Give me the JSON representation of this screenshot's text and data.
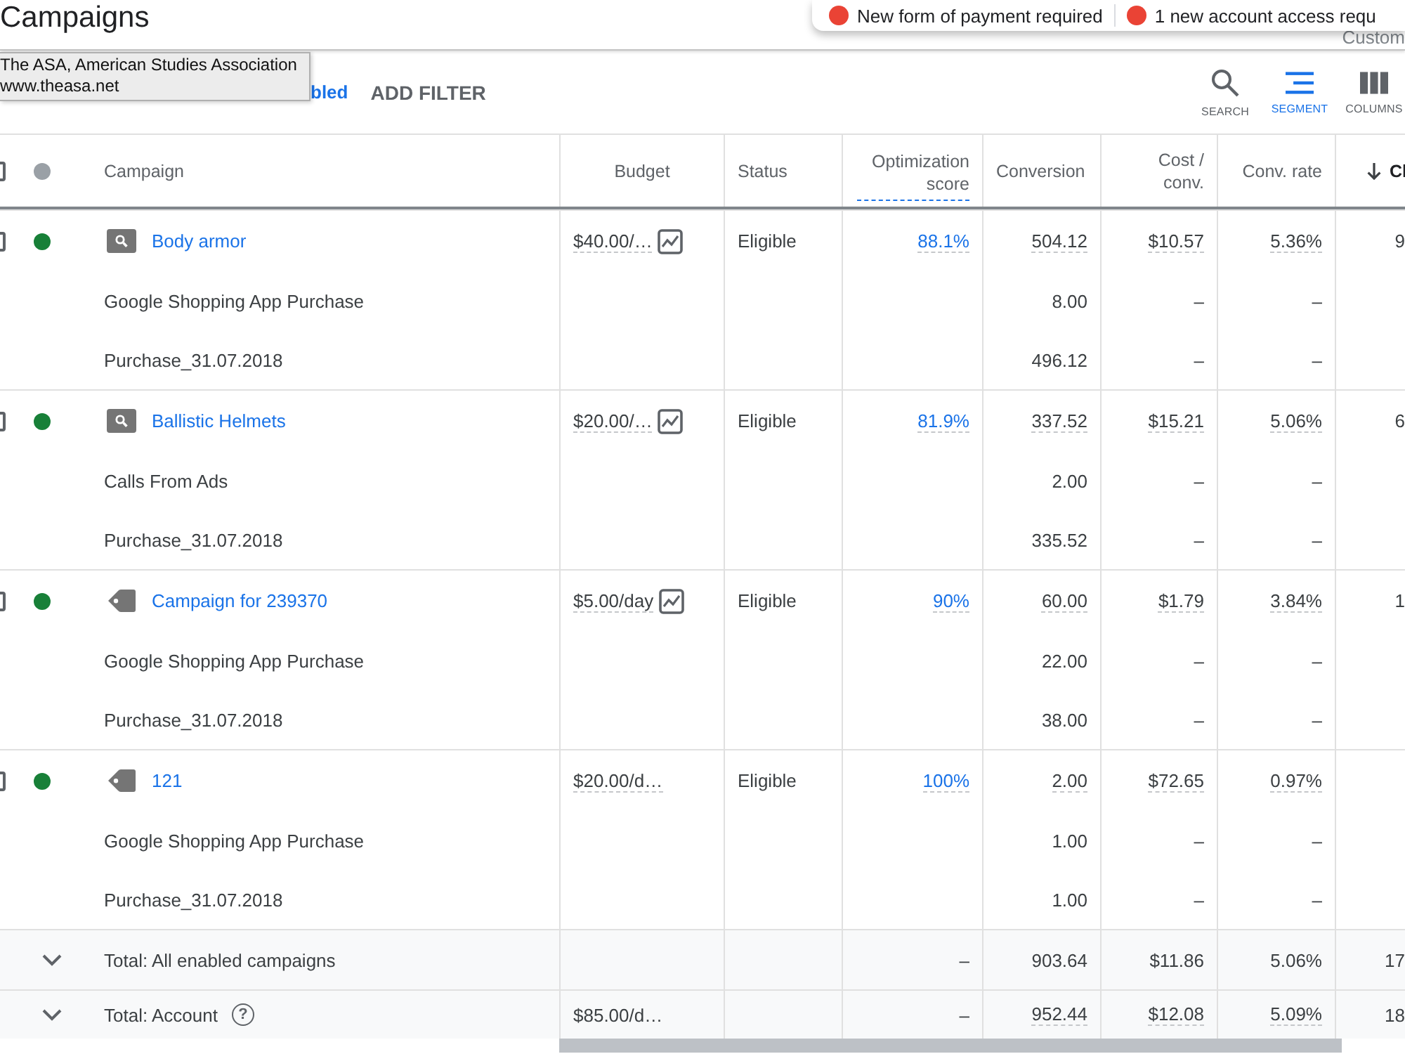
{
  "page": {
    "title": "Campaigns",
    "header_text": "Custom"
  },
  "notifications": [
    {
      "kind": "error",
      "text": "New form of payment required"
    },
    {
      "kind": "error",
      "text": "1 new account access requ"
    }
  ],
  "tooltip": {
    "lines": [
      "The ASA, American Studies Association",
      "www.theasa.net"
    ]
  },
  "filter_bar": {
    "chip_text": "bled",
    "add_filter": "ADD FILTER"
  },
  "toolbar": [
    {
      "kind": "search",
      "label": "SEARCH",
      "selected": false
    },
    {
      "kind": "segment",
      "label": "SEGMENT",
      "selected": true
    },
    {
      "kind": "columns",
      "label": "COLUMNS",
      "selected": false
    }
  ],
  "table": {
    "header": {
      "checked": false,
      "campaign": "Campaign",
      "budget": "Budget",
      "status": "Status",
      "optimization_score": "Optimization score",
      "conversions": "Conversion",
      "cost_per_conv": "Cost / conv.",
      "conv_rate": "Conv. rate",
      "column_10": "Cl",
      "sort_descending": true
    },
    "campaigns": [
      {
        "checked": false,
        "enabled": true,
        "kind": "search",
        "name": "Body armor",
        "budget": "$40.00/…",
        "budget_chart": true,
        "status": "Eligible",
        "optimization_score": "88.1%",
        "conversions": "504.12",
        "cost_per_conv": "$10.57",
        "conv_rate": "5.36%",
        "column_10": "9",
        "conversion_actions": [
          {
            "name": "Google Shopping App Purchase",
            "conversions": "8.00",
            "cost_per_conv": "–",
            "conv_rate": "–"
          },
          {
            "name": "Purchase_31.07.2018",
            "conversions": "496.12",
            "cost_per_conv": "–",
            "conv_rate": "–"
          }
        ]
      },
      {
        "checked": false,
        "enabled": true,
        "kind": "search",
        "name": "Ballistic Helmets",
        "budget": "$20.00/…",
        "budget_chart": true,
        "status": "Eligible",
        "optimization_score": "81.9%",
        "conversions": "337.52",
        "cost_per_conv": "$15.21",
        "conv_rate": "5.06%",
        "column_10": "6",
        "conversion_actions": [
          {
            "name": "Calls From Ads",
            "conversions": "2.00",
            "cost_per_conv": "–",
            "conv_rate": "–"
          },
          {
            "name": "Purchase_31.07.2018",
            "conversions": "335.52",
            "cost_per_conv": "–",
            "conv_rate": "–"
          }
        ]
      },
      {
        "checked": false,
        "enabled": true,
        "kind": "shopping",
        "name": "Campaign for 239370",
        "budget": "$5.00/day",
        "budget_chart": true,
        "status": "Eligible",
        "optimization_score": "90%",
        "conversions": "60.00",
        "cost_per_conv": "$1.79",
        "conv_rate": "3.84%",
        "column_10": "1",
        "conversion_actions": [
          {
            "name": "Google Shopping App Purchase",
            "conversions": "22.00",
            "cost_per_conv": "–",
            "conv_rate": "–"
          },
          {
            "name": "Purchase_31.07.2018",
            "conversions": "38.00",
            "cost_per_conv": "–",
            "conv_rate": "–"
          }
        ]
      },
      {
        "checked": false,
        "enabled": true,
        "kind": "shopping",
        "name": "121",
        "budget": "$20.00/d…",
        "budget_chart": false,
        "status": "Eligible",
        "optimization_score": "100%",
        "conversions": "2.00",
        "cost_per_conv": "$72.65",
        "conv_rate": "0.97%",
        "conversion_actions": [
          {
            "name": "Google Shopping App Purchase",
            "conversions": "1.00",
            "cost_per_conv": "–",
            "conv_rate": "–"
          },
          {
            "name": "Purchase_31.07.2018",
            "conversions": "1.00",
            "cost_per_conv": "–",
            "conv_rate": "–"
          }
        ]
      }
    ],
    "totals": [
      {
        "label": "Total: All enabled campaigns",
        "underlined": false,
        "optimization_score": "–",
        "conversions": "903.64",
        "cost_per_conv": "$11.86",
        "conv_rate": "5.06%",
        "column_10": "17"
      },
      {
        "label": "Total: Account",
        "help": "?",
        "budget": "$85.00/d…",
        "underlined": true,
        "optimization_score": "–",
        "conversions": "952.44",
        "cost_per_conv": "$12.08",
        "conv_rate": "5.09%",
        "column_10": "18"
      }
    ]
  }
}
